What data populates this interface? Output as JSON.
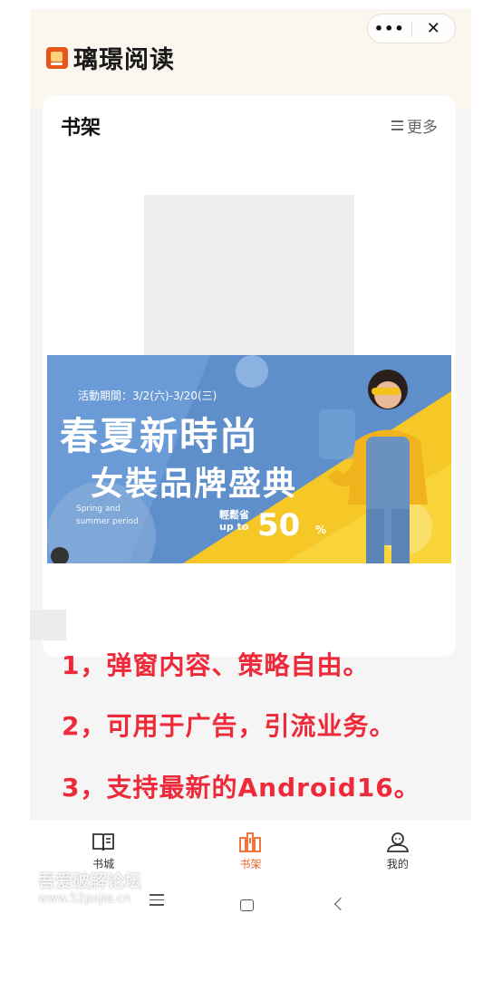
{
  "app": {
    "title": "璃璟阅读",
    "capsule_more": "•••",
    "capsule_close": "✕"
  },
  "shelf": {
    "title": "书架",
    "more_label": "更多"
  },
  "banner": {
    "period": "活動期間：3/2(六)-3/20(三)",
    "title": "春夏新時尚",
    "subtitle": "女裝品牌盛典",
    "english": "Spring and summer period",
    "discount_label": "輕鬆省 up to",
    "discount": "50",
    "discount_unit": "%"
  },
  "notes": [
    "1，弹窗内容、策略自由。",
    "2，可用于广告，引流业务。",
    "3，支持最新的Android16。"
  ],
  "tabs": [
    {
      "label": "书城",
      "icon": "open-book-icon"
    },
    {
      "label": "书架",
      "icon": "bookshelf-icon",
      "active": true
    },
    {
      "label": "我的",
      "icon": "user-icon"
    }
  ],
  "watermark": {
    "main": "吾爱破解论坛",
    "url": "www.52pojie.cn"
  },
  "colors": {
    "accent": "#f0662a",
    "note_red": "#ee2a3a",
    "header_bg": "#fbf7ee",
    "banner_yellow": "#f5c828",
    "banner_blue": "#5e8fcb"
  }
}
